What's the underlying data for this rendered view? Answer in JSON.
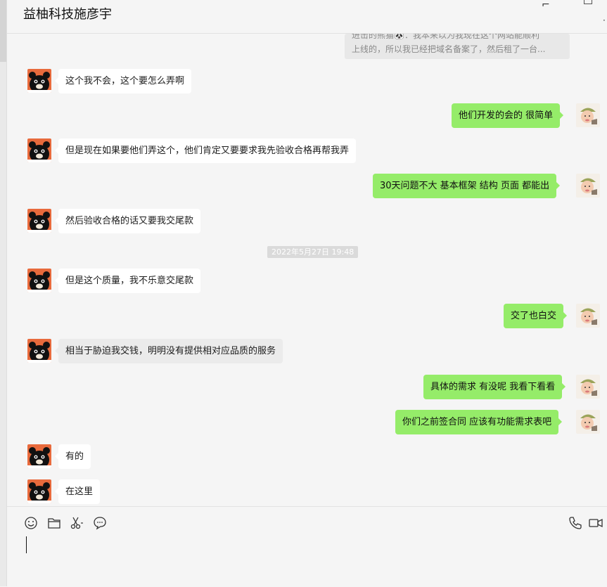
{
  "header": {
    "title": "益柚科技施彦宇"
  },
  "quote": {
    "line1": "进击的熊猫🐼：我本来以为我现在这个网站能顺利",
    "line2": "上线的，所以我已经把域名备案了，然后租了一台..."
  },
  "messages": [
    {
      "side": "in",
      "text": "这个我不会，这个要怎么弄啊"
    },
    {
      "side": "out",
      "text": "他们开发的会的 很简单"
    },
    {
      "side": "in",
      "text": "但是现在如果要他们弄这个，他们肯定又要要求我先验收合格再帮我弄"
    },
    {
      "side": "out",
      "text": "30天问题不大  基本框架 结构 页面 都能出"
    },
    {
      "side": "in",
      "text": "然后验收合格的话又要我交尾款"
    },
    {
      "side": "in",
      "text": "但是这个质量，我不乐意交尾款"
    },
    {
      "side": "out",
      "text": "交了也白交"
    },
    {
      "side": "in",
      "text": "相当于胁迫我交钱，明明没有提供相对应品质的服务"
    },
    {
      "side": "out",
      "text": "具体的需求 有没呢 我看下看看"
    },
    {
      "side": "out",
      "text": "你们之前签合同 应该有功能需求表吧"
    },
    {
      "side": "in",
      "text": "有的"
    },
    {
      "side": "in",
      "text": "在这里"
    }
  ],
  "timestamp": "2022年5月27日 19:48",
  "toolbar": {
    "left_icons": [
      "emoji-icon",
      "folder-icon",
      "scissors-icon",
      "chat-history-icon"
    ],
    "right_icons": [
      "phone-icon",
      "video-icon"
    ]
  },
  "colors": {
    "outgoing_bubble": "#95ec69",
    "incoming_bubble": "#ffffff",
    "background": "#f5f5f5"
  }
}
